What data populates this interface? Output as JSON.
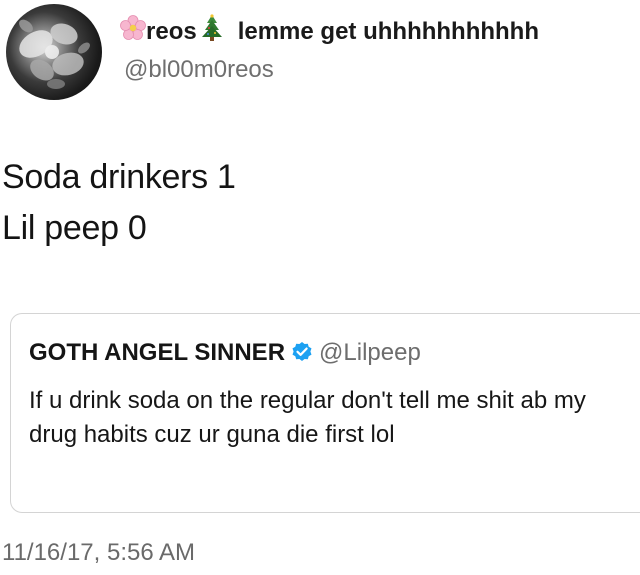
{
  "author": {
    "display_name": "reos",
    "display_name_suffix": "lemme get uhhhhhhhhhhh",
    "handle": "@bl00m0reos",
    "avatar_icon": "floral-avatar",
    "prefix_emoji": "cherry-blossom-icon",
    "suffix_emoji": "christmas-tree-icon"
  },
  "tweet": {
    "lines": [
      "Soda drinkers 1",
      "Lil peep 0"
    ],
    "timestamp": "11/16/17, 5:56 AM"
  },
  "quoted_tweet": {
    "display_name": "GOTH ANGEL SINNER",
    "verified_icon": "verified-badge-icon",
    "handle": "@Lilpeep",
    "text": "If u drink soda on the regular don't tell me shit ab my drug habits cuz ur guna die first lol"
  },
  "colors": {
    "verified_blue": "#1da1f2",
    "secondary_text": "#6f6f6f",
    "card_border": "#d4d4d4"
  }
}
